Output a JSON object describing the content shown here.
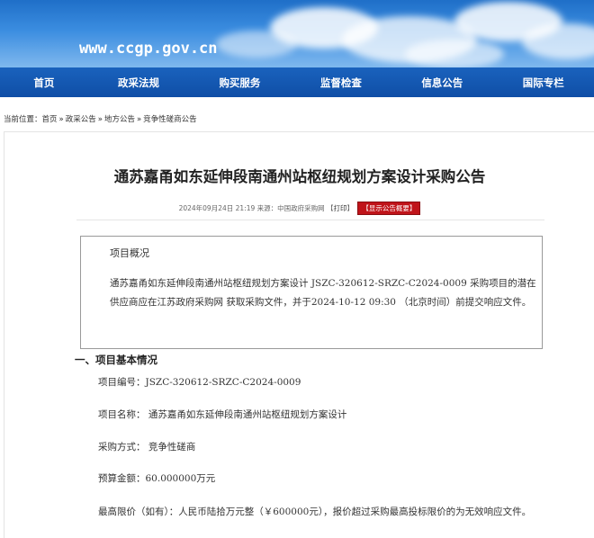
{
  "banner": {
    "site_url": "www.ccgp.gov.cn"
  },
  "nav": {
    "items": [
      "首页",
      "政采法规",
      "购买服务",
      "监督检查",
      "信息公告",
      "国际专栏"
    ]
  },
  "breadcrumb": {
    "label": "当前位置：",
    "items": [
      "首页",
      "政采公告",
      "地方公告",
      "竞争性磋商公告"
    ],
    "separator": "»"
  },
  "article": {
    "title": "通苏嘉甬如东延伸段南通州站枢纽规划方案设计采购公告",
    "meta_text": "2024年09月24日 21:19 来源：中国政府采购网 【",
    "print_label": "打印",
    "meta_close": "】",
    "badge_label": "【显示公告概要】",
    "overview_title": "项目概况",
    "overview_text": "通苏嘉甬如东延伸段南通州站枢纽规划方案设计 JSZC-320612-SRZC-C2024-0009 采购项目的潜在供应商应在江苏政府采购网 获取采购文件，并于2024-10-12 09:30 （北京时间）前提交响应文件。",
    "section_title": "一、项目基本情况",
    "fields": [
      "项目编号：JSZC-320612-SRZC-C2024-0009",
      "项目名称： 通苏嘉甬如东延伸段南通州站枢纽规划方案设计",
      "采购方式： 竞争性磋商",
      "预算金额：60.000000万元",
      "最高限价（如有）：人民币陆拾万元整（￥600000元），报价超过采购最高投标限价的为无效响应文件。"
    ]
  }
}
